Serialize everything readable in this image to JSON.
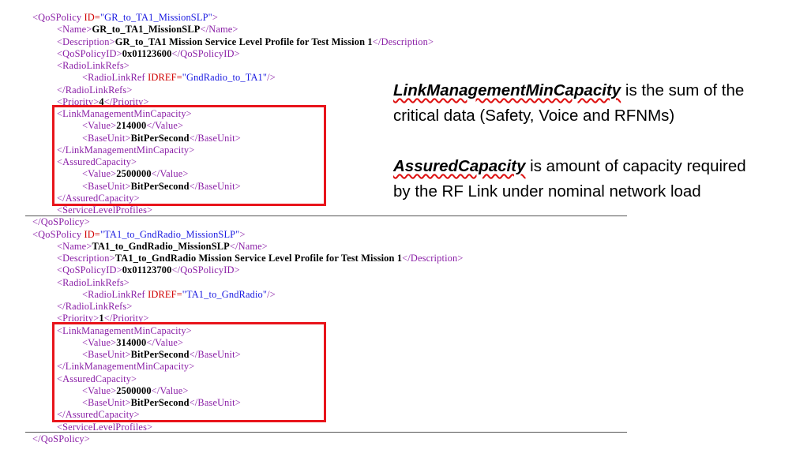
{
  "xml_lines": [
    {
      "indent": 41,
      "parts": [
        {
          "t": "tag",
          "v": "<QoSPolicy "
        },
        {
          "t": "attr",
          "v": "ID="
        },
        {
          "t": "aval",
          "v": "\"GR_to_TA1_MissionSLP\""
        },
        {
          "t": "tag",
          "v": ">"
        }
      ]
    },
    {
      "indent": 72,
      "parts": [
        {
          "t": "tag",
          "v": "<Name>"
        },
        {
          "t": "txt",
          "v": "GR_to_TA1_MissionSLP"
        },
        {
          "t": "tag",
          "v": "</Name>"
        }
      ]
    },
    {
      "indent": 72,
      "parts": [
        {
          "t": "tag",
          "v": "<Description>"
        },
        {
          "t": "txt",
          "v": "GR_to_TA1 Mission Service Level Profile for Test Mission 1"
        },
        {
          "t": "tag",
          "v": "</Description>"
        }
      ]
    },
    {
      "indent": 72,
      "parts": [
        {
          "t": "tag",
          "v": "<QoSPolicyID>"
        },
        {
          "t": "txt",
          "v": "0x01123600"
        },
        {
          "t": "tag",
          "v": "</QoSPolicyID>"
        }
      ]
    },
    {
      "indent": 72,
      "parts": [
        {
          "t": "tag",
          "v": "<RadioLinkRefs>"
        }
      ]
    },
    {
      "indent": 104,
      "parts": [
        {
          "t": "tag",
          "v": "<RadioLinkRef "
        },
        {
          "t": "attr",
          "v": "IDREF="
        },
        {
          "t": "aval",
          "v": "\"GndRadio_to_TA1\""
        },
        {
          "t": "tag",
          "v": "/>"
        }
      ]
    },
    {
      "indent": 72,
      "parts": [
        {
          "t": "tag",
          "v": "</RadioLinkRefs>"
        }
      ]
    },
    {
      "indent": 72,
      "parts": [
        {
          "t": "tag",
          "v": "<Priority>"
        },
        {
          "t": "txt",
          "v": "4"
        },
        {
          "t": "tag",
          "v": "</Priority>"
        }
      ]
    },
    {
      "indent": 72,
      "parts": [
        {
          "t": "tag",
          "v": "<LinkManagementMinCapacity>"
        }
      ]
    },
    {
      "indent": 104,
      "parts": [
        {
          "t": "tag",
          "v": "<Value>"
        },
        {
          "t": "txt",
          "v": "214000"
        },
        {
          "t": "tag",
          "v": "</Value>"
        }
      ]
    },
    {
      "indent": 104,
      "parts": [
        {
          "t": "tag",
          "v": "<BaseUnit>"
        },
        {
          "t": "txt",
          "v": "BitPerSecond"
        },
        {
          "t": "tag",
          "v": "</BaseUnit>"
        }
      ]
    },
    {
      "indent": 72,
      "parts": [
        {
          "t": "tag",
          "v": "</LinkManagementMinCapacity>"
        }
      ]
    },
    {
      "indent": 72,
      "parts": [
        {
          "t": "tag",
          "v": "<AssuredCapacity>"
        }
      ]
    },
    {
      "indent": 104,
      "parts": [
        {
          "t": "tag",
          "v": "<Value>"
        },
        {
          "t": "txt",
          "v": "2500000"
        },
        {
          "t": "tag",
          "v": "</Value>"
        }
      ]
    },
    {
      "indent": 104,
      "parts": [
        {
          "t": "tag",
          "v": "<BaseUnit>"
        },
        {
          "t": "txt",
          "v": "BitPerSecond"
        },
        {
          "t": "tag",
          "v": "</BaseUnit>"
        }
      ]
    },
    {
      "indent": 72,
      "parts": [
        {
          "t": "tag",
          "v": "</AssuredCapacity>"
        }
      ]
    },
    {
      "indent": 72,
      "parts": [
        {
          "t": "tag",
          "v": "<ServiceLevelProfiles>"
        }
      ]
    },
    {
      "indent": 41,
      "parts": [
        {
          "t": "tag",
          "v": "</QoSPolicy>"
        }
      ]
    },
    {
      "indent": 41,
      "parts": [
        {
          "t": "tag",
          "v": "<QoSPolicy "
        },
        {
          "t": "attr",
          "v": "ID="
        },
        {
          "t": "aval",
          "v": "\"TA1_to_GndRadio_MissionSLP\""
        },
        {
          "t": "tag",
          "v": ">"
        }
      ]
    },
    {
      "indent": 72,
      "parts": [
        {
          "t": "tag",
          "v": "<Name>"
        },
        {
          "t": "txt",
          "v": "TA1_to_GndRadio_MissionSLP"
        },
        {
          "t": "tag",
          "v": "</Name>"
        }
      ]
    },
    {
      "indent": 72,
      "parts": [
        {
          "t": "tag",
          "v": "<Description>"
        },
        {
          "t": "txt",
          "v": "TA1_to_GndRadio Mission Service Level Profile for Test Mission 1"
        },
        {
          "t": "tag",
          "v": "</Description>"
        }
      ]
    },
    {
      "indent": 72,
      "parts": [
        {
          "t": "tag",
          "v": "<QoSPolicyID>"
        },
        {
          "t": "txt",
          "v": "0x01123700"
        },
        {
          "t": "tag",
          "v": "</QoSPolicyID>"
        }
      ]
    },
    {
      "indent": 72,
      "parts": [
        {
          "t": "tag",
          "v": "<RadioLinkRefs>"
        }
      ]
    },
    {
      "indent": 104,
      "parts": [
        {
          "t": "tag",
          "v": "<RadioLinkRef "
        },
        {
          "t": "attr",
          "v": "IDREF="
        },
        {
          "t": "aval",
          "v": "\"TA1_to_GndRadio\""
        },
        {
          "t": "tag",
          "v": "/>"
        }
      ]
    },
    {
      "indent": 72,
      "parts": [
        {
          "t": "tag",
          "v": "</RadioLinkRefs>"
        }
      ]
    },
    {
      "indent": 72,
      "parts": [
        {
          "t": "tag",
          "v": "<Priority>"
        },
        {
          "t": "txt",
          "v": "1"
        },
        {
          "t": "tag",
          "v": "</Priority>"
        }
      ]
    },
    {
      "indent": 72,
      "parts": [
        {
          "t": "tag",
          "v": "<LinkManagementMinCapacity>"
        }
      ]
    },
    {
      "indent": 104,
      "parts": [
        {
          "t": "tag",
          "v": "<Value>"
        },
        {
          "t": "txt",
          "v": "314000"
        },
        {
          "t": "tag",
          "v": "</Value>"
        }
      ]
    },
    {
      "indent": 104,
      "parts": [
        {
          "t": "tag",
          "v": "<BaseUnit>"
        },
        {
          "t": "txt",
          "v": "BitPerSecond"
        },
        {
          "t": "tag",
          "v": "</BaseUnit>"
        }
      ]
    },
    {
      "indent": 72,
      "parts": [
        {
          "t": "tag",
          "v": "</LinkManagementMinCapacity>"
        }
      ]
    },
    {
      "indent": 72,
      "parts": [
        {
          "t": "tag",
          "v": "<AssuredCapacity>"
        }
      ]
    },
    {
      "indent": 104,
      "parts": [
        {
          "t": "tag",
          "v": "<Value>"
        },
        {
          "t": "txt",
          "v": "2500000"
        },
        {
          "t": "tag",
          "v": "</Value>"
        }
      ]
    },
    {
      "indent": 104,
      "parts": [
        {
          "t": "tag",
          "v": "<BaseUnit>"
        },
        {
          "t": "txt",
          "v": "BitPerSecond"
        },
        {
          "t": "tag",
          "v": "</BaseUnit>"
        }
      ]
    },
    {
      "indent": 72,
      "parts": [
        {
          "t": "tag",
          "v": "</AssuredCapacity>"
        }
      ]
    },
    {
      "indent": 72,
      "parts": [
        {
          "t": "tag",
          "v": "<ServiceLevelProfiles>"
        }
      ]
    },
    {
      "indent": 41,
      "parts": [
        {
          "t": "tag",
          "v": "</QoSPolicy>"
        }
      ]
    }
  ],
  "notes": {
    "link_term": "LinkManagementMinCapacity",
    "link_line1_rest": " is the sum of the",
    "link_line2": "critical data (Safety, Voice and RFNMs)",
    "assured_term": "AssuredCapacity",
    "assured_line1_rest": " is amount of capacity required",
    "assured_line2": "by the RF Link under nominal network load"
  },
  "colors": {
    "tag": "#8a1fa6",
    "attribute": "#d00000",
    "attribute_value": "#1818e0",
    "text": "#000000",
    "highlight_box": "#e8141b"
  }
}
